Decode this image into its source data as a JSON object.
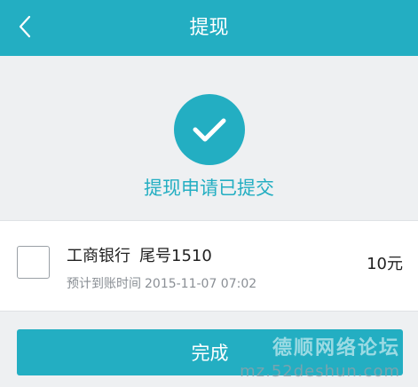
{
  "header": {
    "title": "提现",
    "back_icon": "chevron-left-icon"
  },
  "status": {
    "icon": "check-icon",
    "message": "提现申请已提交"
  },
  "withdrawal": {
    "bank_name": "工商银行",
    "card_tail": "尾号1510",
    "eta_label": "预计到账时间",
    "eta_value": "2015-11-07 07:02",
    "amount": "10元"
  },
  "actions": {
    "done_label": "完成"
  },
  "watermark": {
    "cn": "德顺网络论坛",
    "url": "mz.52deshun.com"
  },
  "colors": {
    "accent": "#23aec2",
    "background": "#eef0f2"
  }
}
